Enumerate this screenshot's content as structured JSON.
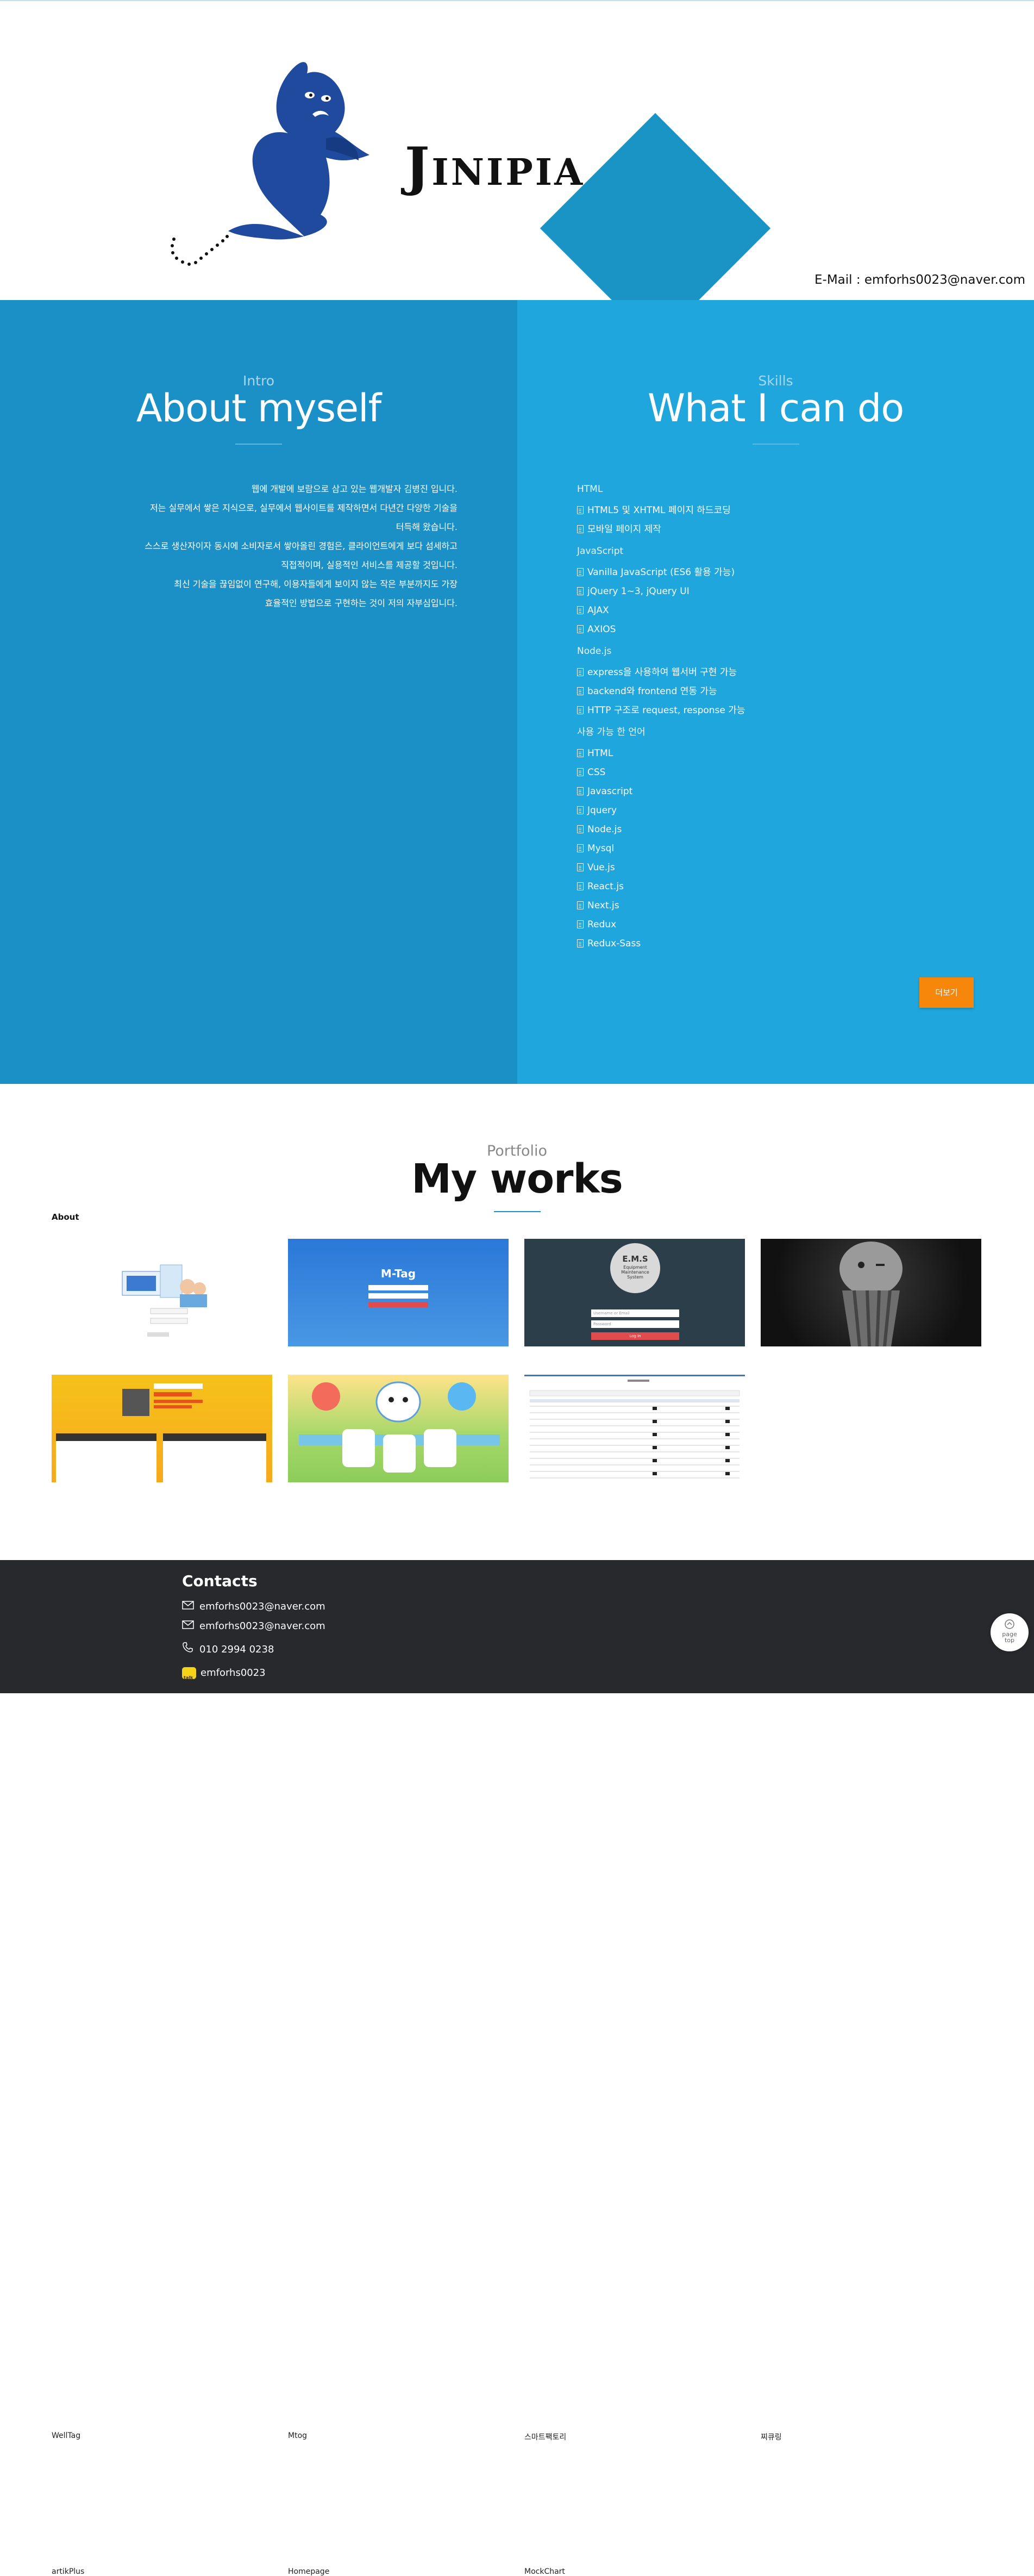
{
  "header": {
    "logo_text": "Jinipia",
    "email": "E-Mail : emforhs0023@naver.com",
    "colors": {
      "triangle": "#1a94c4",
      "genie": "#1f4a9e"
    }
  },
  "intro": {
    "subtitle": "Intro",
    "title": "About myself",
    "lines": [
      "웹에 개발에 보람으로 삼고 있는 웹개발자 김병진 입니다.",
      "저는 실무에서 쌓은 지식으로, 실무에서 웹사이트를 제작하면서 다년간 다양한 기술을",
      "터득해 왔습니다.",
      "스스로 생산자이자 동시에 소비자로서 쌓아올린 경험은, 클라이언트에게 보다 섬세하고",
      "직접적이며, 실용적인 서비스를 제공할 것입니다.",
      "최신 기술을 끊임없이 연구해, 이용자들에게 보이지 않는 작은 부분까지도 가장",
      "효율적인 방법으로 구현하는 것이 저의 자부심입니다."
    ]
  },
  "skills": {
    "subtitle": "Skills",
    "title": "What I can do",
    "groups": [
      {
        "name": "HTML",
        "items": [
          "HTML5 및 XHTML 페이지 하드코딩",
          "모바일 페이지 제작"
        ]
      },
      {
        "name": "JavaScript",
        "items": [
          "Vanilla JavaScript (ES6 활용 가능)",
          "jQuery 1~3, jQuery UI",
          "AJAX",
          "AXIOS"
        ]
      },
      {
        "name": "Node.js",
        "items": [
          "express을 사용하여 웹서버 구현 가능",
          "backend와 frontend 연동 가능",
          "HTTP 구조로 request, response 가능"
        ]
      },
      {
        "name": "사용 가능 한 언어",
        "items": [
          "HTML",
          "CSS",
          "Javascript",
          "Jquery",
          "Node.js",
          "Mysql",
          "Vue.js",
          "React.js",
          "Next.js",
          "Redux",
          "Redux-Sass"
        ]
      }
    ],
    "more_label": "더보기"
  },
  "portfolio": {
    "subtitle": "Portfolio",
    "title": "My works",
    "about_label": "About",
    "cards": [
      {
        "label": "WellTag"
      },
      {
        "label": "Mtog",
        "thumb_title": "M-Tag"
      },
      {
        "label": "스마트팩토리",
        "thumb_title": "E.M.S",
        "thumb_sub": "Equipment Maintenance System",
        "thumb_btn": "Log In",
        "thumb_user": "Username or Email",
        "thumb_pass": "Password"
      },
      {
        "label": "찌큐링"
      },
      {
        "label": "artikPlus"
      },
      {
        "label": "Homepage"
      },
      {
        "label": "MockChart"
      }
    ]
  },
  "footer": {
    "title": "Contacts",
    "email1": "emforhs0023@naver.com",
    "email2": "emforhs0023@naver.com",
    "phone": "010 2994 0238",
    "kakao": "emforhs0023",
    "page_top_label": "page top"
  }
}
